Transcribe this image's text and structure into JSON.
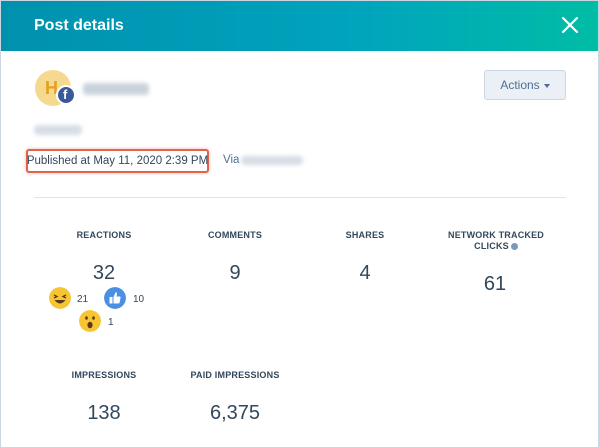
{
  "header": {
    "title": "Post details"
  },
  "account": {
    "avatar_initial": "H"
  },
  "actions": {
    "label": "Actions"
  },
  "post": {
    "published": "Published at May 11, 2020 2:39 PM",
    "via_label": "Via"
  },
  "stats": {
    "reactions": {
      "label": "REACTIONS",
      "value": "32",
      "breakdown": [
        {
          "icon": "laughing-emoji-icon",
          "count": "21"
        },
        {
          "icon": "thumbs-up-icon",
          "count": "10"
        },
        {
          "icon": "surprised-emoji-icon",
          "count": "1"
        }
      ]
    },
    "comments": {
      "label": "COMMENTS",
      "value": "9"
    },
    "shares": {
      "label": "SHARES",
      "value": "4"
    },
    "clicks": {
      "label_line1": "NETWORK TRACKED",
      "label_line2": "CLICKS",
      "value": "61"
    },
    "impressions": {
      "label": "IMPRESSIONS",
      "value": "138"
    },
    "paid_impressions": {
      "label": "PAID IMPRESSIONS",
      "value": "6,375"
    }
  },
  "colors": {
    "header_start": "#0091ae",
    "header_end": "#00bda5",
    "highlight": "#e0634a",
    "facebook": "#3b5998"
  }
}
